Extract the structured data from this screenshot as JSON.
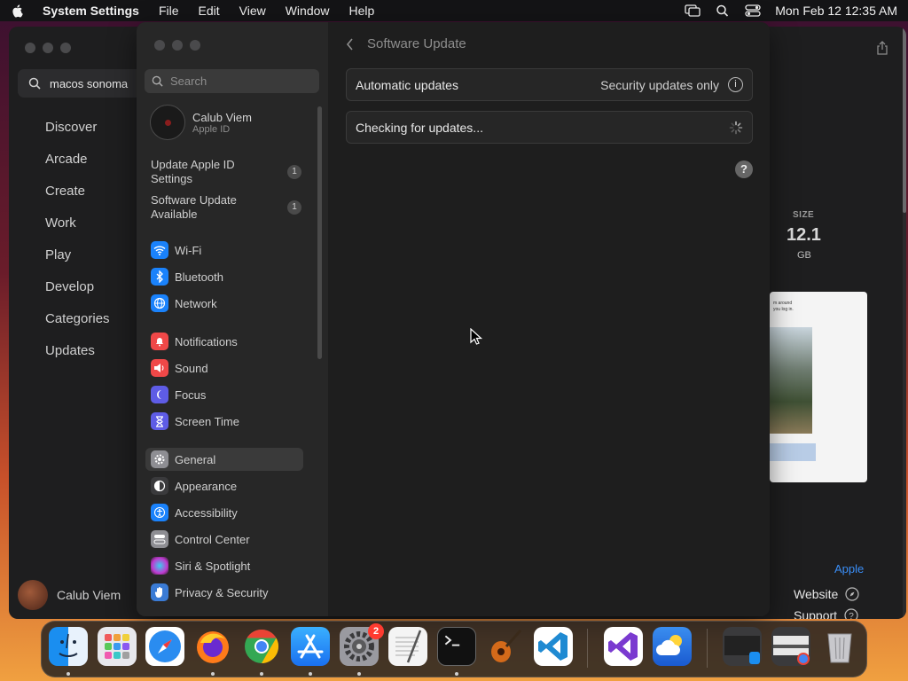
{
  "menubar": {
    "app_name": "System Settings",
    "menus": [
      "File",
      "Edit",
      "View",
      "Window",
      "Help"
    ],
    "datetime": "Mon Feb 12  12:35 AM"
  },
  "app_store": {
    "search_value": "macos sonoma",
    "nav": [
      "Discover",
      "Arcade",
      "Create",
      "Work",
      "Play",
      "Develop",
      "Categories",
      "Updates"
    ],
    "user_name": "Calub Viem",
    "size_label": "SIZE",
    "size_value": "12.1",
    "size_unit": "GB",
    "screenshot_text": "m around\nyou log in.",
    "developer_link": "Apple",
    "website_label": "Website",
    "support_label": "Support"
  },
  "settings": {
    "search_placeholder": "Search",
    "account": {
      "name": "Calub Viem",
      "subtitle": "Apple ID"
    },
    "pending": [
      {
        "label": "Update Apple ID Settings",
        "count": "1"
      },
      {
        "label": "Software Update Available",
        "count": "1"
      }
    ],
    "sidebar_items": [
      {
        "label": "Wi-Fi",
        "color": "#1a82fb"
      },
      {
        "label": "Bluetooth",
        "color": "#1a82fb"
      },
      {
        "label": "Network",
        "color": "#1a82fb"
      },
      {
        "label": "Notifications",
        "color": "#f04848"
      },
      {
        "label": "Sound",
        "color": "#f04848"
      },
      {
        "label": "Focus",
        "color": "#5e5ce6"
      },
      {
        "label": "Screen Time",
        "color": "#5e5ce6"
      },
      {
        "label": "General",
        "color": "#8e8e93"
      },
      {
        "label": "Appearance",
        "color": "#3a3a3c"
      },
      {
        "label": "Accessibility",
        "color": "#1a82fb"
      },
      {
        "label": "Control Center",
        "color": "#8e8e93"
      },
      {
        "label": "Siri & Spotlight",
        "color": "#c03ad0"
      },
      {
        "label": "Privacy & Security",
        "color": "#3a7bd5"
      }
    ],
    "selected_item": "General",
    "page_title": "Software Update",
    "auto_updates": {
      "label": "Automatic updates",
      "value": "Security updates only",
      "info_glyph": "i"
    },
    "status_text": "Checking for updates...",
    "help_glyph": "?"
  },
  "dock": {
    "apps": [
      "Finder",
      "Launchpad",
      "Safari",
      "Firefox",
      "Chrome",
      "App Store",
      "System Settings",
      "TextEdit",
      "Terminal",
      "GarageBand",
      "VS Code",
      "Visual Studio",
      "Weather",
      "Window Preview 1",
      "Window Preview 2",
      "Trash"
    ],
    "settings_badge": "2"
  }
}
